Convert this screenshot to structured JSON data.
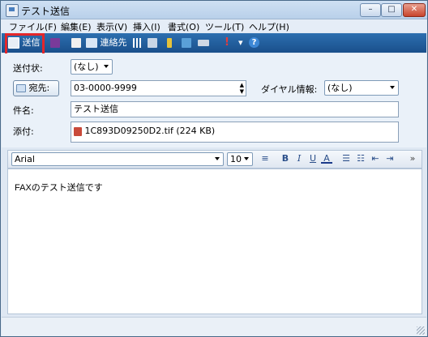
{
  "window": {
    "title": "テスト送信",
    "min": "–",
    "max": "□",
    "close": "✕"
  },
  "menu": [
    "ファイル(F)",
    "編集(E)",
    "表示(V)",
    "挿入(I)",
    "書式(O)",
    "ツール(T)",
    "ヘルプ(H)"
  ],
  "toolbar": {
    "send_label": "送信",
    "contacts_label": "連絡先",
    "exclaim": "!",
    "dropdown": "▾",
    "help": "?"
  },
  "form": {
    "send_type_label": "送付状:",
    "send_type_value": "(なし)",
    "to_button_label": "宛先:",
    "to_value": "03-0000-9999",
    "dial_info_label": "ダイヤル情報:",
    "dial_info_value": "(なし)",
    "subject_label": "件名:",
    "subject_value": "テスト送信",
    "attach_label": "添付:",
    "attachment_name": "1C893D09250D2.tif (224 KB)"
  },
  "format": {
    "font_name": "Arial",
    "font_size": "10",
    "bold": "B",
    "italic": "I",
    "underline": "U",
    "font_color": "A",
    "more": "»"
  },
  "editor": {
    "body": "FAXのテスト送信です"
  },
  "colors": {
    "toolbar": "#1f5b9c",
    "highlight": "#e3262a",
    "panel": "#eaf1f9"
  }
}
